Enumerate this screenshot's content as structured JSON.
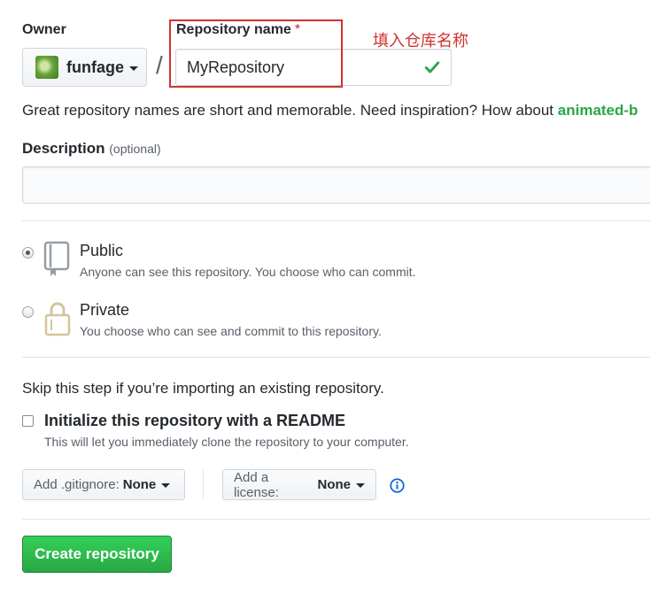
{
  "owner": {
    "label": "Owner",
    "name": "funfage"
  },
  "repo_name": {
    "label": "Repository name",
    "required_marker": "*",
    "value": "MyRepository"
  },
  "annotation": {
    "text": "填入仓库名称",
    "color": "#d1322f"
  },
  "hint": {
    "text": "Great repository names are short and memorable. Need inspiration? How about ",
    "suggestion": "animated-b"
  },
  "description": {
    "label": "Description",
    "optional": "(optional)",
    "value": ""
  },
  "visibility": {
    "public": {
      "title": "Public",
      "desc": "Anyone can see this repository. You choose who can commit.",
      "checked": true
    },
    "private": {
      "title": "Private",
      "desc": "You choose who can see and commit to this repository.",
      "checked": false
    }
  },
  "import_note": "Skip this step if you’re importing an existing repository.",
  "readme": {
    "label": "Initialize this repository with a README",
    "desc": "This will let you immediately clone the repository to your computer.",
    "checked": false
  },
  "gitignore": {
    "label": "Add .gitignore:",
    "value": "None"
  },
  "license": {
    "label": "Add a license:",
    "value": "None"
  },
  "create_button": "Create repository",
  "colors": {
    "accent_green": "#28a745",
    "link_blue": "#0366d6"
  }
}
